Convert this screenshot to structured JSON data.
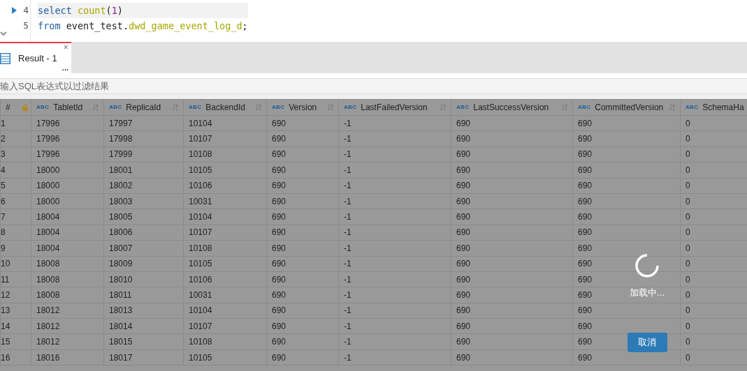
{
  "editor": {
    "lines": [
      {
        "number": "4",
        "current": true,
        "tokens": [
          {
            "kind": "keyword",
            "text": "select"
          },
          {
            "kind": "function",
            "text": "count"
          },
          {
            "kind": "plain",
            "text": "("
          },
          {
            "kind": "number",
            "text": "1"
          },
          {
            "kind": "plain",
            "text": ")"
          }
        ]
      },
      {
        "number": "5",
        "current": false,
        "tokens": [
          {
            "kind": "keyword",
            "text": "from"
          },
          {
            "kind": "plain",
            "text": "event_test."
          },
          {
            "kind": "table",
            "text": "dwd_game_event_log_d"
          },
          {
            "kind": "plain",
            "text": ";"
          }
        ]
      }
    ]
  },
  "tabs": [
    {
      "label": "Result - 1",
      "selected": true,
      "close": "×",
      "more": "..."
    }
  ],
  "filter": {
    "placeholder": "输入SQL表达式以过滤结果"
  },
  "table": {
    "columns": [
      {
        "label": "#",
        "kind": "index"
      },
      {
        "label": "TabletId",
        "kind": "data",
        "type": "ABC"
      },
      {
        "label": "ReplicaId",
        "kind": "data",
        "type": "ABC"
      },
      {
        "label": "BackendId",
        "kind": "data",
        "type": "ABC"
      },
      {
        "label": "Version",
        "kind": "data",
        "type": "ABC"
      },
      {
        "label": "LastFailedVersion",
        "kind": "data",
        "type": "ABC"
      },
      {
        "label": "LastSuccessVersion",
        "kind": "data",
        "type": "ABC"
      },
      {
        "label": "CommittedVersion",
        "kind": "data",
        "type": "ABC"
      },
      {
        "label": "SchemaHa",
        "kind": "cut",
        "type": "ABC"
      }
    ],
    "rows": [
      [
        "1",
        "17996",
        "17997",
        "10104",
        "690",
        "-1",
        "690",
        "690",
        "0"
      ],
      [
        "2",
        "17996",
        "17998",
        "10107",
        "690",
        "-1",
        "690",
        "690",
        "0"
      ],
      [
        "3",
        "17996",
        "17999",
        "10108",
        "690",
        "-1",
        "690",
        "690",
        "0"
      ],
      [
        "4",
        "18000",
        "18001",
        "10105",
        "690",
        "-1",
        "690",
        "690",
        "0"
      ],
      [
        "5",
        "18000",
        "18002",
        "10106",
        "690",
        "-1",
        "690",
        "690",
        "0"
      ],
      [
        "6",
        "18000",
        "18003",
        "10031",
        "690",
        "-1",
        "690",
        "690",
        "0"
      ],
      [
        "7",
        "18004",
        "18005",
        "10104",
        "690",
        "-1",
        "690",
        "690",
        "0"
      ],
      [
        "8",
        "18004",
        "18006",
        "10107",
        "690",
        "-1",
        "690",
        "690",
        "0"
      ],
      [
        "9",
        "18004",
        "18007",
        "10108",
        "690",
        "-1",
        "690",
        "690",
        "0"
      ],
      [
        "10",
        "18008",
        "18009",
        "10105",
        "690",
        "-1",
        "690",
        "690",
        "0"
      ],
      [
        "11",
        "18008",
        "18010",
        "10106",
        "690",
        "-1",
        "690",
        "690",
        "0"
      ],
      [
        "12",
        "18008",
        "18011",
        "10031",
        "690",
        "-1",
        "690",
        "690",
        "0"
      ],
      [
        "13",
        "18012",
        "18013",
        "10104",
        "690",
        "-1",
        "690",
        "690",
        "0"
      ],
      [
        "14",
        "18012",
        "18014",
        "10107",
        "690",
        "-1",
        "690",
        "690",
        "0"
      ],
      [
        "15",
        "18012",
        "18015",
        "10108",
        "690",
        "-1",
        "690",
        "690",
        "0"
      ],
      [
        "16",
        "18016",
        "18017",
        "10105",
        "690",
        "-1",
        "690",
        "690",
        "0"
      ]
    ]
  },
  "loading": {
    "text": "加载中...",
    "cancel": "取消"
  }
}
